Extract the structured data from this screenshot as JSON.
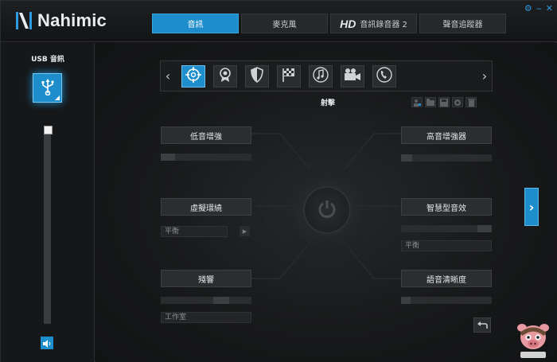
{
  "app": {
    "logo_text": "Nahimic"
  },
  "tabs": [
    {
      "label": "音訊",
      "active": true
    },
    {
      "label": "麥克風",
      "active": false
    },
    {
      "prefix": "HD",
      "label": "音訊錄音器 2",
      "active": false
    },
    {
      "label": "聲音追蹤器",
      "active": false
    }
  ],
  "left_panel": {
    "device_title": "USB 音訊",
    "volume": 1.0
  },
  "presets": {
    "items": [
      "crosshair-icon",
      "award-ribbon-icon",
      "shield-icon",
      "racing-flag-icon",
      "music-note-icon",
      "video-camera-icon",
      "phone-icon"
    ],
    "active_index": 0,
    "active_name": "射擊"
  },
  "features": {
    "bass_boost": {
      "label": "低音增強"
    },
    "treble_boost": {
      "label": "高音增強器"
    },
    "virtual_surround": {
      "label": "虛擬環繞",
      "dropdown": "平衡"
    },
    "smart_volume": {
      "label": "智慧型音效",
      "dropdown": "平衡"
    },
    "reverb": {
      "label": "殘響",
      "dropdown": "工作室"
    },
    "voice_clarity": {
      "label": "語音清晰度"
    }
  },
  "colors": {
    "accent": "#1d8dcc",
    "background": "#141516"
  }
}
